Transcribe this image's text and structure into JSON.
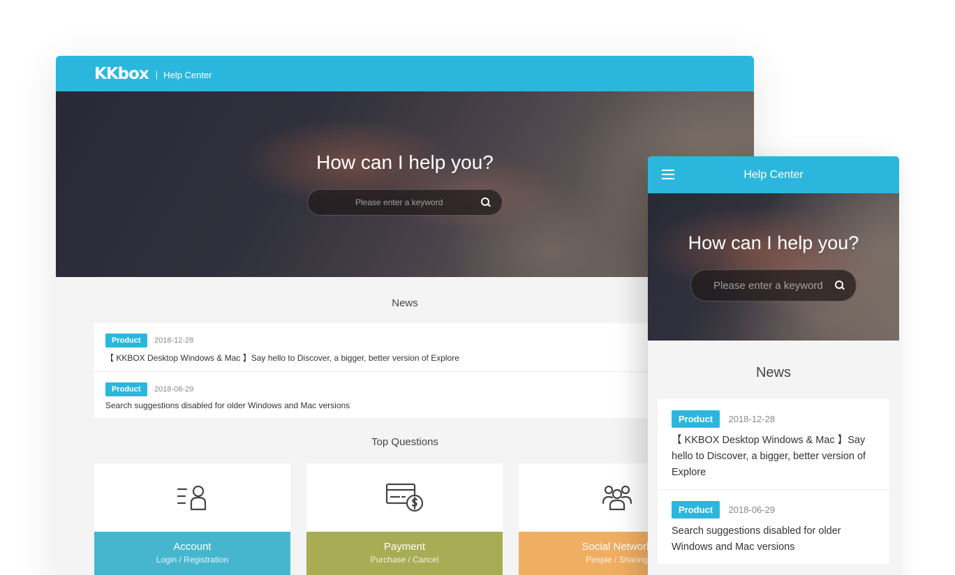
{
  "desktop": {
    "header": {
      "logo": "KKbox",
      "separator": "|",
      "title": "Help Center"
    },
    "hero": {
      "heading": "How can I help you?",
      "search_placeholder": "Please enter a keyword"
    },
    "news": {
      "title": "News",
      "items": [
        {
          "badge": "Product",
          "date": "2018-12-28",
          "text": "【 KKBOX Desktop Windows & Mac 】Say hello to Discover, a bigger, better version of Explore"
        },
        {
          "badge": "Product",
          "date": "2018-06-29",
          "text": "Search suggestions disabled for older Windows and Mac versions"
        }
      ]
    },
    "top_questions": {
      "title": "Top Questions",
      "cards": [
        {
          "title": "Account",
          "subtitle": "Login / Registration",
          "icon": "account-list-icon",
          "color": "#46b6cf"
        },
        {
          "title": "Payment",
          "subtitle": "Purchase / Cancel",
          "icon": "payment-card-icon",
          "color": "#a8ac55"
        },
        {
          "title": "Social Network",
          "subtitle": "People / Sharing",
          "icon": "people-group-icon",
          "color": "#f0ae63"
        }
      ]
    }
  },
  "mobile": {
    "header": {
      "menu_icon": "hamburger-icon",
      "title": "Help Center"
    },
    "hero": {
      "heading": "How can I help you?",
      "search_placeholder": "Please enter a keyword"
    },
    "news": {
      "title": "News",
      "items": [
        {
          "badge": "Product",
          "date": "2018-12-28",
          "text": "【 KKBOX Desktop Windows & Mac 】Say hello to Discover, a bigger, better version of Explore"
        },
        {
          "badge": "Product",
          "date": "2018-06-29",
          "text": "Search suggestions disabled for older Windows and Mac versions"
        }
      ]
    }
  },
  "colors": {
    "brand": "#2bb7dd",
    "background": "#f4f4f4"
  }
}
